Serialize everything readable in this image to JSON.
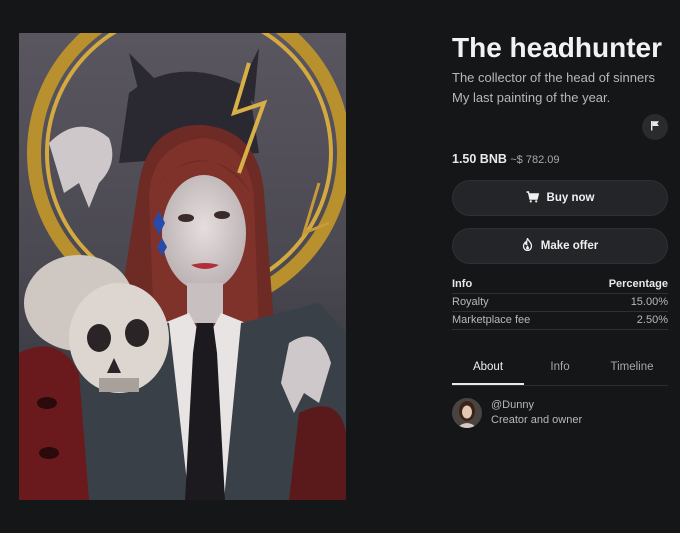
{
  "artwork": {
    "alt": "Painting of a red-haired woman in a suit holding skulls"
  },
  "nft": {
    "title": "The headhunter",
    "description_line1": "The collector of the head of sinners",
    "description_line2": "My last painting of the year."
  },
  "price": {
    "amount": "1.50 BNB",
    "fiat": "~$ 782.09"
  },
  "actions": {
    "buy_label": "Buy now",
    "offer_label": "Make offer"
  },
  "info_table": {
    "header_left": "Info",
    "header_right": "Percentage",
    "rows": [
      {
        "label": "Royalty",
        "value": "15.00%"
      },
      {
        "label": "Marketplace fee",
        "value": "2.50%"
      }
    ]
  },
  "tabs": [
    {
      "label": "About",
      "active": true
    },
    {
      "label": "Info",
      "active": false
    },
    {
      "label": "Timeline",
      "active": false
    }
  ],
  "creator": {
    "handle": "@Dunny",
    "role": "Creator and owner"
  },
  "icons": {
    "flag": "flag-icon",
    "cart": "cart-icon",
    "fire": "fire-icon"
  },
  "colors": {
    "background": "#151618",
    "button_bg": "#242528",
    "text": "#e8e8e8",
    "muted": "#b8b8bc"
  }
}
